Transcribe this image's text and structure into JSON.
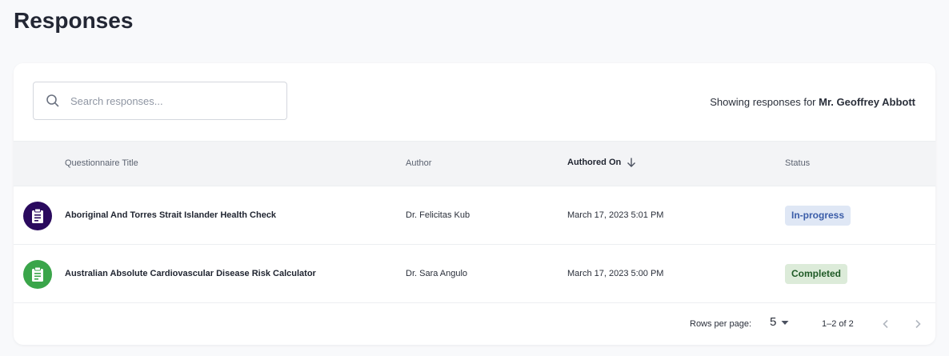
{
  "page": {
    "title": "Responses"
  },
  "search": {
    "placeholder": "Search responses..."
  },
  "showing": {
    "prefix": "Showing responses for",
    "patient": "Mr. Geoffrey Abbott"
  },
  "table": {
    "columns": {
      "title": "Questionnaire Title",
      "author": "Author",
      "authored_on": "Authored On",
      "status": "Status"
    },
    "rows": [
      {
        "title": "Aboriginal And Torres Strait Islander Health Check",
        "author": "Dr. Felicitas Kub",
        "authored_on": "March 17, 2023 5:01 PM",
        "status": "In-progress",
        "icon": "clipboard-icon",
        "icon_bg": "#2a0a5e",
        "status_bg": "#dfe7f5",
        "status_color": "#3a5ca8"
      },
      {
        "title": "Australian Absolute Cardiovascular Disease Risk Calculator",
        "author": "Dr. Sara Angulo",
        "authored_on": "March 17, 2023 5:00 PM",
        "status": "Completed",
        "icon": "clipboard-icon",
        "icon_bg": "#3aa54a",
        "status_bg": "#dcebd9",
        "status_color": "#1f5a26"
      }
    ]
  },
  "pagination": {
    "rows_per_page_label": "Rows per page:",
    "rows_per_page": "5",
    "range": "1–2 of 2"
  }
}
